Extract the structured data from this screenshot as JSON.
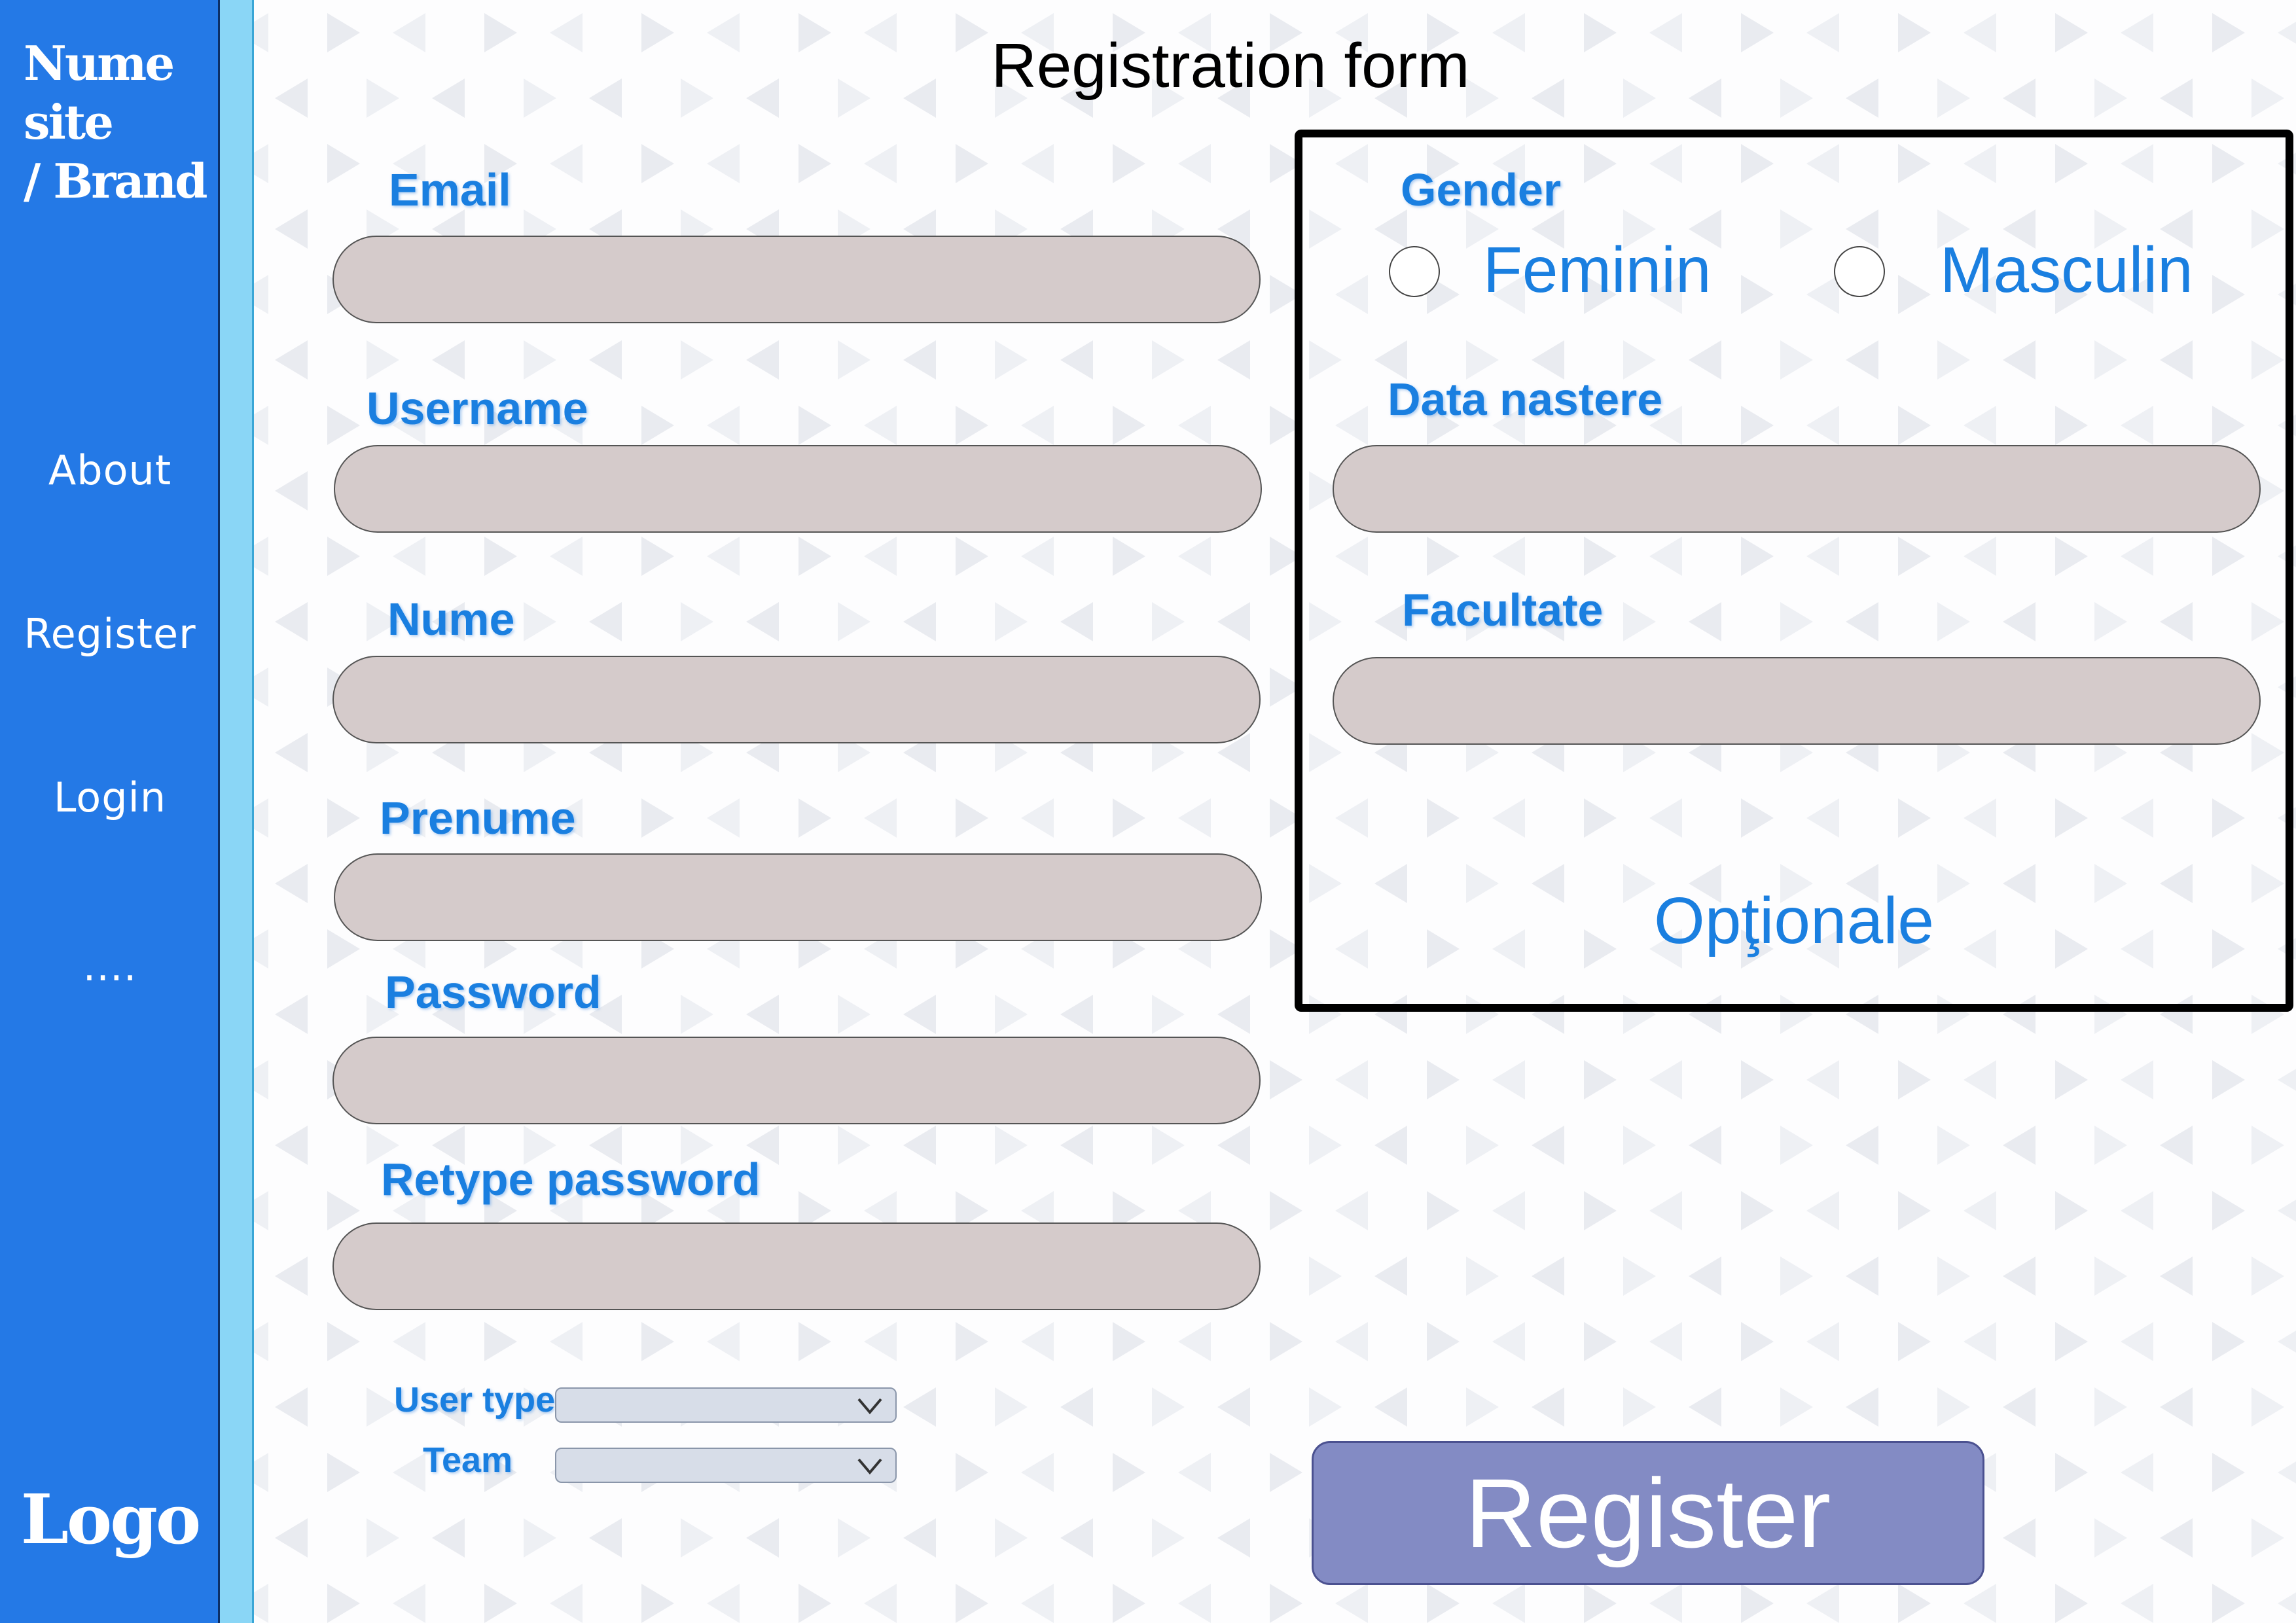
{
  "sidebar": {
    "brand": "Nume site\n/ Brand",
    "items": [
      {
        "label": "About"
      },
      {
        "label": "Register"
      },
      {
        "label": "Login"
      },
      {
        "label": "...."
      }
    ],
    "logo": "Logo",
    "colors": {
      "panel": "#2479e6",
      "stripe": "#8ad6f6"
    }
  },
  "page": {
    "title": "Registration form"
  },
  "form": {
    "email_label": "Email",
    "username_label": "Username",
    "nume_label": "Nume",
    "prenume_label": "Prenume",
    "password_label": "Password",
    "retype_password_label": "Retype password",
    "user_type_label": "User type",
    "team_label": "Team",
    "field_fill": "#d5cbcb",
    "label_color": "#1a7fe0"
  },
  "optional": {
    "gender_label": "Gender",
    "gender_options": [
      {
        "label": "Feminin",
        "selected": false
      },
      {
        "label": "Masculin",
        "selected": false
      }
    ],
    "birth_date_label": "Data nastere",
    "faculty_label": "Facultate",
    "caption": "Opţionale"
  },
  "actions": {
    "register_label": "Register",
    "register_color": "#838bc4"
  }
}
